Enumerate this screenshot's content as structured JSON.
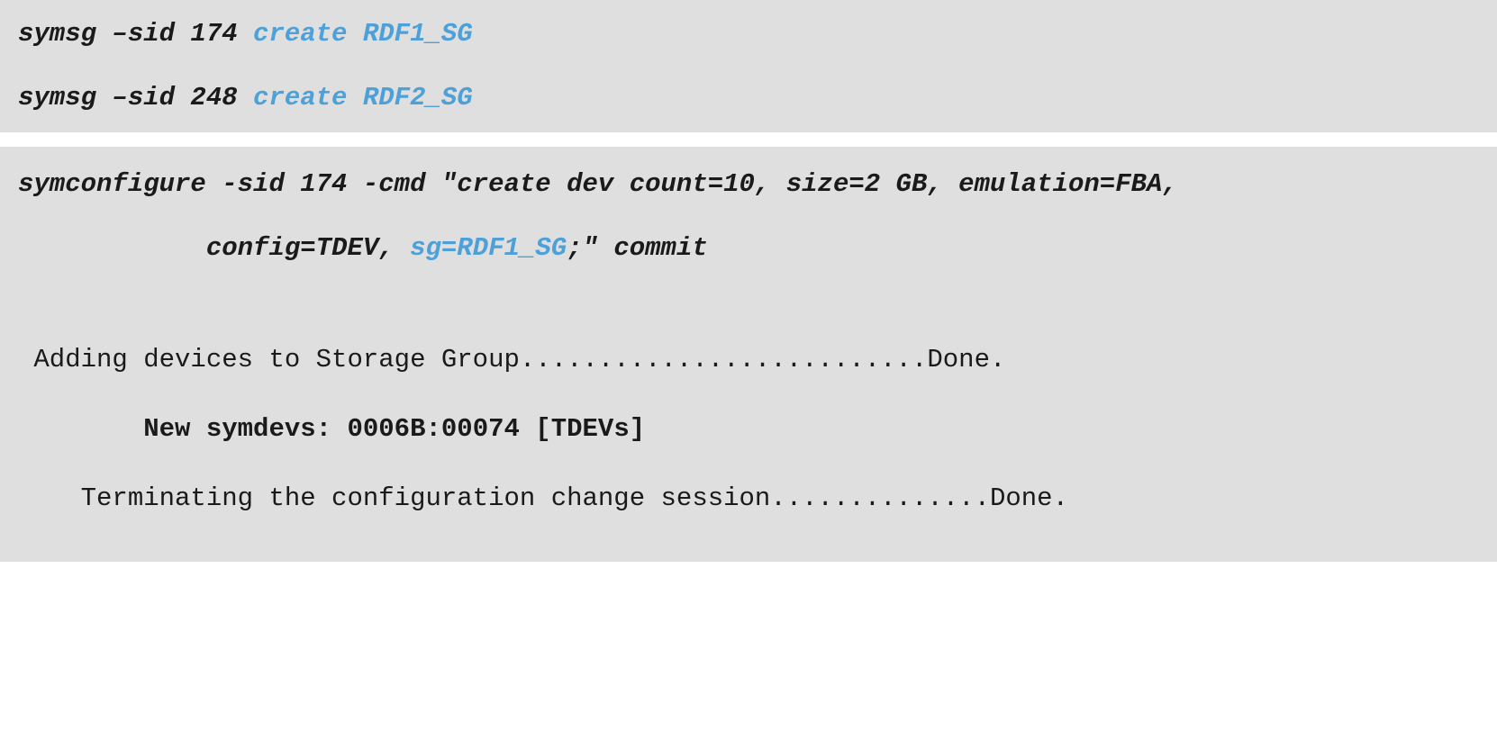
{
  "block1": {
    "line1": {
      "part1": "symsg –sid 174 ",
      "part2": "create RDF1_SG"
    },
    "line2": {
      "part1": "symsg –sid 248 ",
      "part2": "create RDF2_SG"
    }
  },
  "block2": {
    "line1": "symconfigure -sid 174 -cmd \"create dev count=10, size=2 GB, emulation=FBA,",
    "line2": {
      "indent": "            ",
      "part1": "config=TDEV, ",
      "part2": "sg=RDF1_SG",
      "part3": ";\" commit"
    },
    "line3": " Adding devices to Storage Group..........................Done.",
    "line4": {
      "indent": "        ",
      "text": "New symdevs: 0006B:00074 [TDEVs]"
    },
    "line5": "    Terminating the configuration change session..............Done."
  }
}
